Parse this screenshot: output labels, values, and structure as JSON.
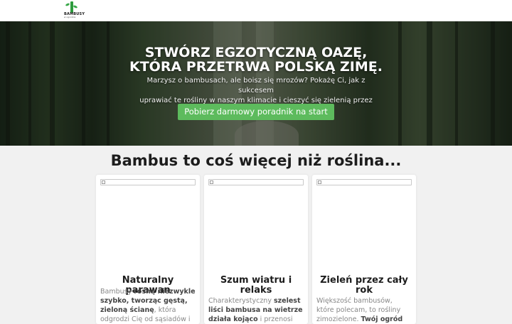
{
  "logo": {
    "brand": "BAMBUSY",
    "tagline": "w ogrodzie",
    "icon": "bamboo-logo-icon"
  },
  "hero": {
    "headline_1": "STWÓRZ EGZOTYCZNĄ OAZĘ,",
    "headline_2": "KTÓRA PRZETRWA POLSKĄ ZIMĘ.",
    "lead_1": "Marzysz o bambusach, ale boisz się mrozów? Pokażę Ci, jak z sukcesem",
    "lead_2": "uprawiać te rośliny w naszym klimacie i cieszyć się zielenią przez cały rok.",
    "cta": "Pobierz darmowy poradnik na start"
  },
  "section": {
    "title": "Bambus to coś więcej niż roślina..."
  },
  "cards": [
    {
      "title": "Naturalny parawan",
      "t1": "Bambusy ",
      "b1": "rosną niezwykle szybko, tworząc gęstą, zieloną ścianę",
      "t2": ", która",
      "t3": "odgrodzi Cię od sąsiadów i"
    },
    {
      "title": "Szum wiatru i relaks",
      "t1": "Charakterystyczny ",
      "b1": "szelest liści bambusa na wietrze działa kojąco",
      "t2": " i przenosi myśli"
    },
    {
      "title": "Zieleń przez cały rok",
      "t1": "Większość bambusów, które polecam, to rośliny zimozielone. ",
      "b1": "Twój ogród"
    }
  ],
  "colors": {
    "accent": "#5dbb5d",
    "logo_green": "#2e9b3e"
  }
}
